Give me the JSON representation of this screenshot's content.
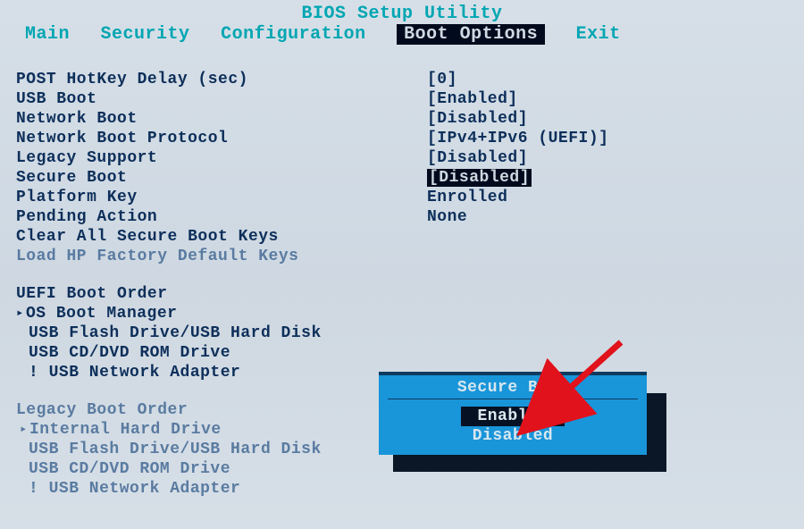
{
  "title": "BIOS Setup Utility",
  "menu": {
    "items": [
      "Main",
      "Security",
      "Configuration",
      "Boot Options",
      "Exit"
    ],
    "activeIndex": 3
  },
  "settings": [
    {
      "label": "POST HotKey Delay (sec)",
      "value": "[0]"
    },
    {
      "label": "USB Boot",
      "value": "[Enabled]"
    },
    {
      "label": "Network Boot",
      "value": "[Disabled]"
    },
    {
      "label": "Network Boot Protocol",
      "value": "[IPv4+IPv6 (UEFI)]"
    },
    {
      "label": "Legacy Support",
      "value": "[Disabled]"
    },
    {
      "label": "Secure Boot",
      "value": "[Disabled]",
      "selected": true
    },
    {
      "label": "Platform Key",
      "value": "Enrolled"
    },
    {
      "label": "Pending Action",
      "value": "None"
    },
    {
      "label": "Clear All Secure Boot Keys",
      "value": ""
    },
    {
      "label": "Load HP Factory Default Keys",
      "value": "",
      "dim": true
    }
  ],
  "uefi": {
    "heading": "UEFI Boot Order",
    "items": [
      {
        "label": "OS Boot Manager",
        "tri": true
      },
      {
        "label": "USB Flash Drive/USB Hard Disk"
      },
      {
        "label": "USB CD/DVD ROM Drive"
      },
      {
        "label": "! USB Network Adapter"
      }
    ]
  },
  "legacy": {
    "heading": "Legacy Boot Order",
    "items": [
      {
        "label": "Internal Hard Drive",
        "tri": true
      },
      {
        "label": "USB Flash Drive/USB Hard Disk"
      },
      {
        "label": "USB CD/DVD ROM Drive"
      },
      {
        "label": "! USB Network Adapter"
      }
    ]
  },
  "popup": {
    "title": "Secure Boot",
    "options": [
      "Enabled",
      "Disabled"
    ],
    "selectedIndex": 0
  }
}
